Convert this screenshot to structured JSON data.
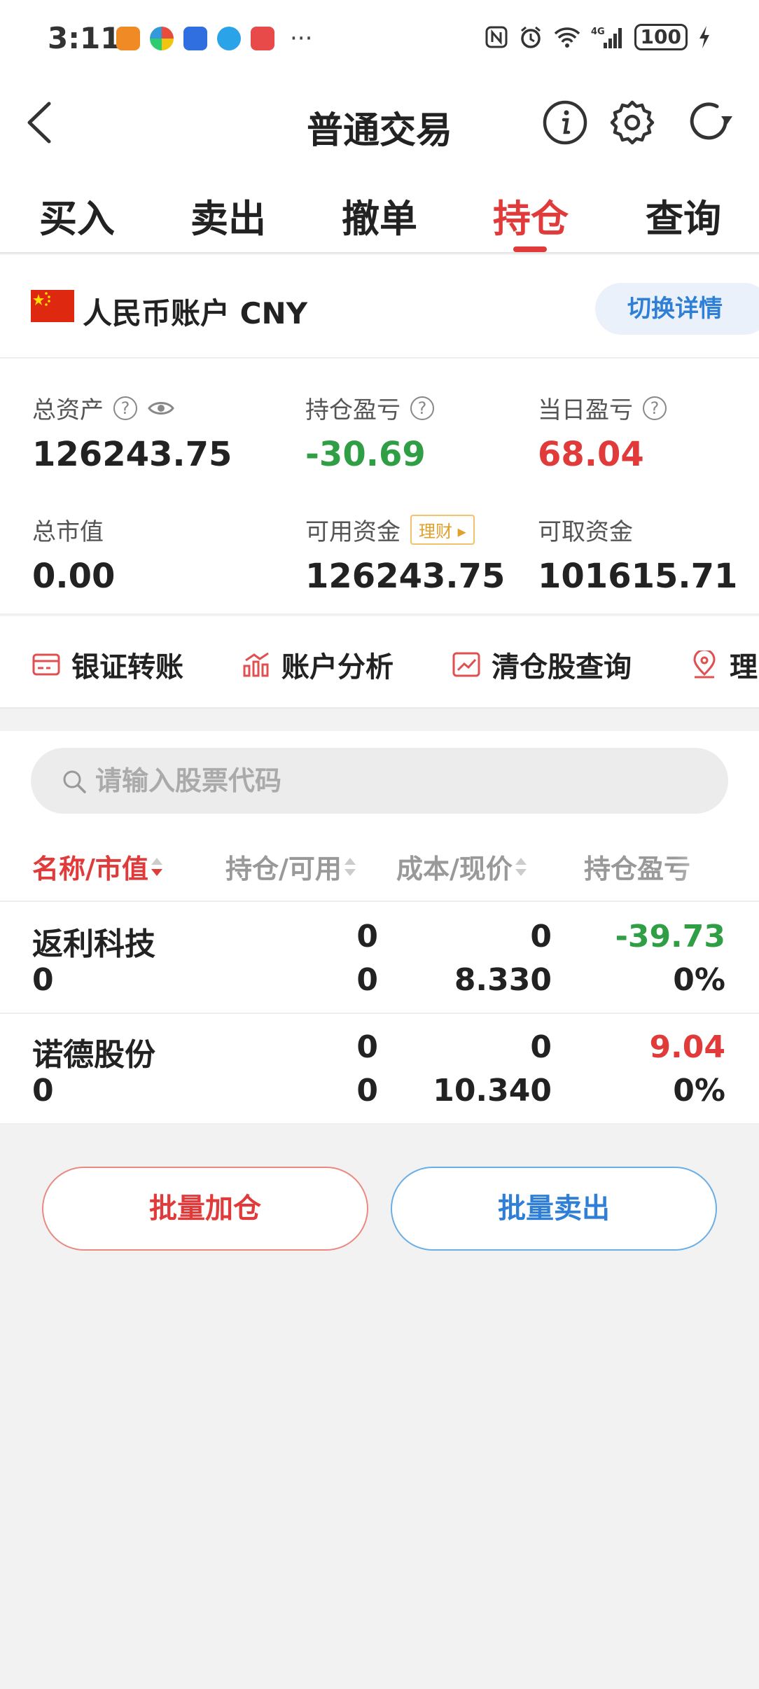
{
  "status_bar": {
    "time": "3:11",
    "battery": "100",
    "network": "4G"
  },
  "nav": {
    "title": "普通交易"
  },
  "tabs": [
    {
      "label": "买入"
    },
    {
      "label": "卖出"
    },
    {
      "label": "撤单"
    },
    {
      "label": "持仓",
      "active": true
    },
    {
      "label": "查询"
    }
  ],
  "account": {
    "name": "人民币账户 CNY",
    "switch_label": "切换详情"
  },
  "assets": {
    "total_assets": {
      "label": "总资产",
      "value": "126243.75"
    },
    "position_pl": {
      "label": "持仓盈亏",
      "value": "-30.69"
    },
    "daily_pl": {
      "label": "当日盈亏",
      "value": "68.04"
    },
    "market_value": {
      "label": "总市值",
      "value": "0.00"
    },
    "available_funds": {
      "label": "可用资金",
      "value": "126243.75",
      "badge": "理财"
    },
    "withdrawable_funds": {
      "label": "可取资金",
      "value": "101615.71"
    }
  },
  "quick_links": [
    {
      "label": "银证转账",
      "icon": "card-icon"
    },
    {
      "label": "账户分析",
      "icon": "bar-chart-icon"
    },
    {
      "label": "清仓股查询",
      "icon": "trend-chart-icon"
    },
    {
      "label": "理",
      "icon": "location-icon"
    }
  ],
  "search": {
    "placeholder": "请输入股票代码"
  },
  "table": {
    "headers": [
      "名称/市值",
      "持仓/可用",
      "成本/现价",
      "持仓盈亏"
    ],
    "rows": [
      {
        "name": "返利科技",
        "market_value": "0",
        "position": "0",
        "available": "0",
        "cost": "0",
        "price": "8.330",
        "pl": "-39.73",
        "pl_pct": "0%"
      },
      {
        "name": "诺德股份",
        "market_value": "0",
        "position": "0",
        "available": "0",
        "cost": "0",
        "price": "10.340",
        "pl": "9.04",
        "pl_pct": "0%"
      }
    ]
  },
  "actions": {
    "batch_add": "批量加仓",
    "batch_sell": "批量卖出"
  },
  "colors": {
    "accent_red": "#e03a3a",
    "loss_green": "#2f9e44",
    "link_blue": "#2f7fd6"
  }
}
